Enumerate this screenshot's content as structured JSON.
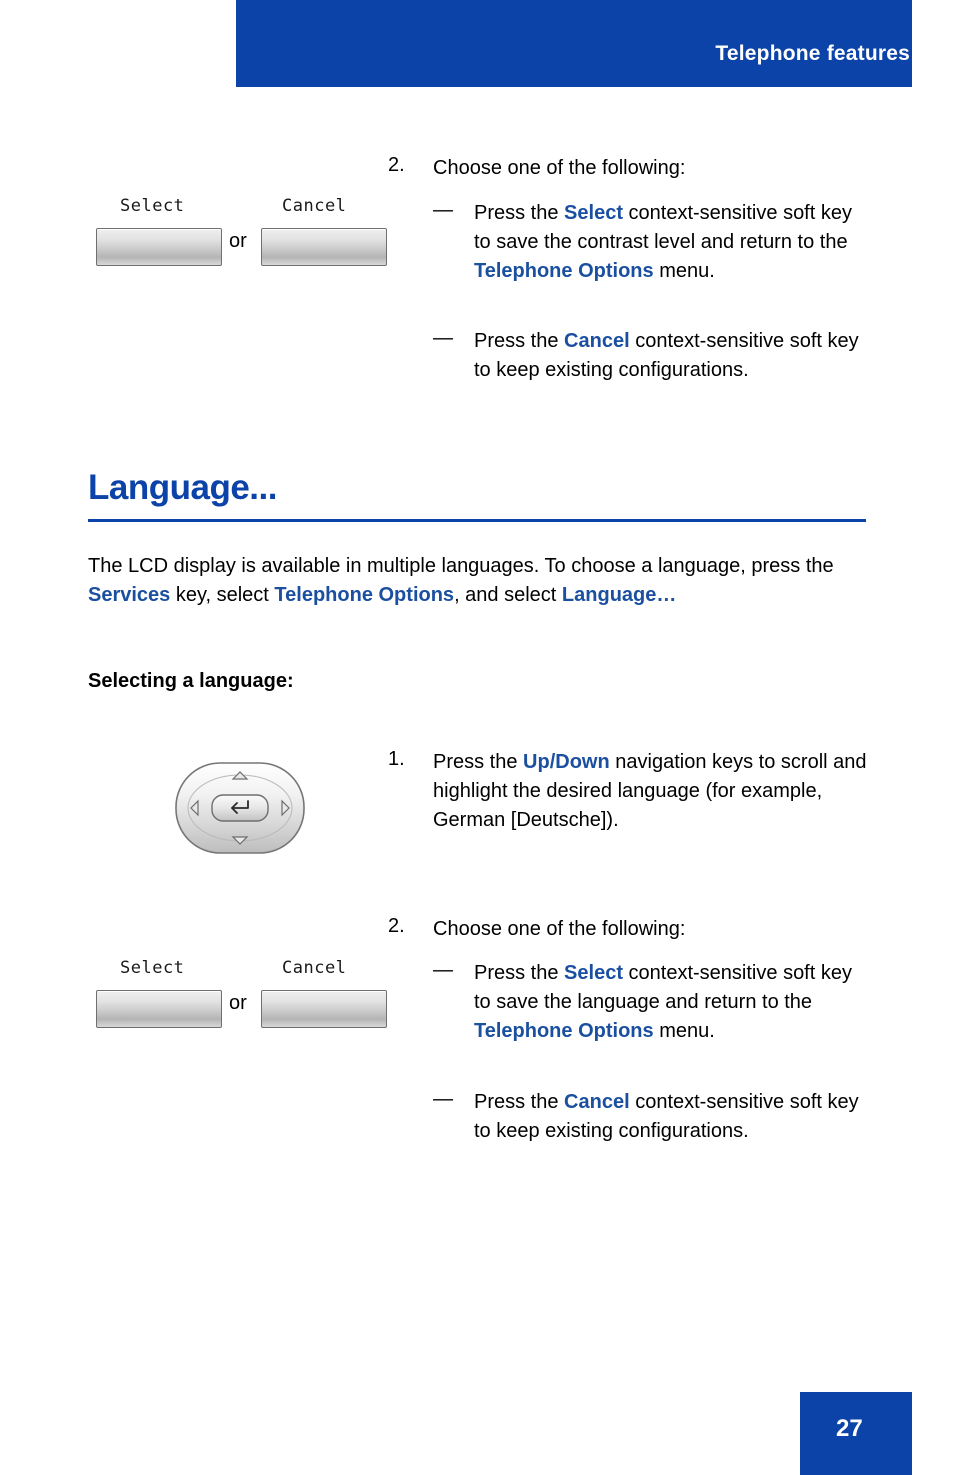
{
  "header": {
    "title": "Telephone features"
  },
  "contrast_step": {
    "number": "2.",
    "title": "Choose one of the following:",
    "bullets": [
      {
        "dash": "—",
        "line1_pre": "Press the ",
        "key": "Select",
        "line1_post": " context-sensitive",
        "line2": "soft key to save the contrast level",
        "line3_pre": "and return to the ",
        "menu1": "Telephone",
        "menu2": "Options",
        "line4_post": " menu."
      },
      {
        "dash": "—",
        "line1_pre": "Press the ",
        "key": "Cancel",
        "line1_post": " context-sensitive",
        "line2": "soft key to keep existing",
        "line3": "configurations."
      }
    ],
    "softkeys": {
      "select_label": "Select",
      "cancel_label": "Cancel",
      "or": "or"
    }
  },
  "section": {
    "heading": "Language...",
    "paragraph": {
      "line1": "The LCD display is available in multiple languages. To choose a",
      "line2_pre": "language, press the ",
      "services": "Services",
      "line2_mid": " key, select ",
      "telephone_options": "Telephone Options",
      "line2_post": ", and select",
      "language": "Language…"
    },
    "subhead": "Selecting a language:"
  },
  "language_step1": {
    "number": "1.",
    "line1_pre": "Press the ",
    "key": "Up/Down",
    "line1_post": " navigation keys to",
    "line2": "scroll and highlight the desired language",
    "line3": "(for example, German [Deutsche])."
  },
  "language_step2": {
    "number": "2.",
    "title": " Choose one of the following:",
    "bullets": [
      {
        "dash": "—",
        "line1_pre": "Press the ",
        "key": "Select",
        "line1_post": " context-sensitive",
        "line2": "soft key to save the language and",
        "line3_pre": "return to the ",
        "menu": "Telephone Options",
        "line4": "menu."
      },
      {
        "dash": "—",
        "line1_pre": "Press the ",
        "key": "Cancel",
        "line1_post": " context-sensitive",
        "line2": "soft key to keep existing",
        "line3": "configurations."
      }
    ],
    "softkeys": {
      "select_label": "Select",
      "cancel_label": "Cancel",
      "or": "or"
    }
  },
  "footer": {
    "page_number": "27"
  },
  "colors": {
    "brand_blue": "#0b43a8",
    "link_blue": "#1b4fa0"
  }
}
